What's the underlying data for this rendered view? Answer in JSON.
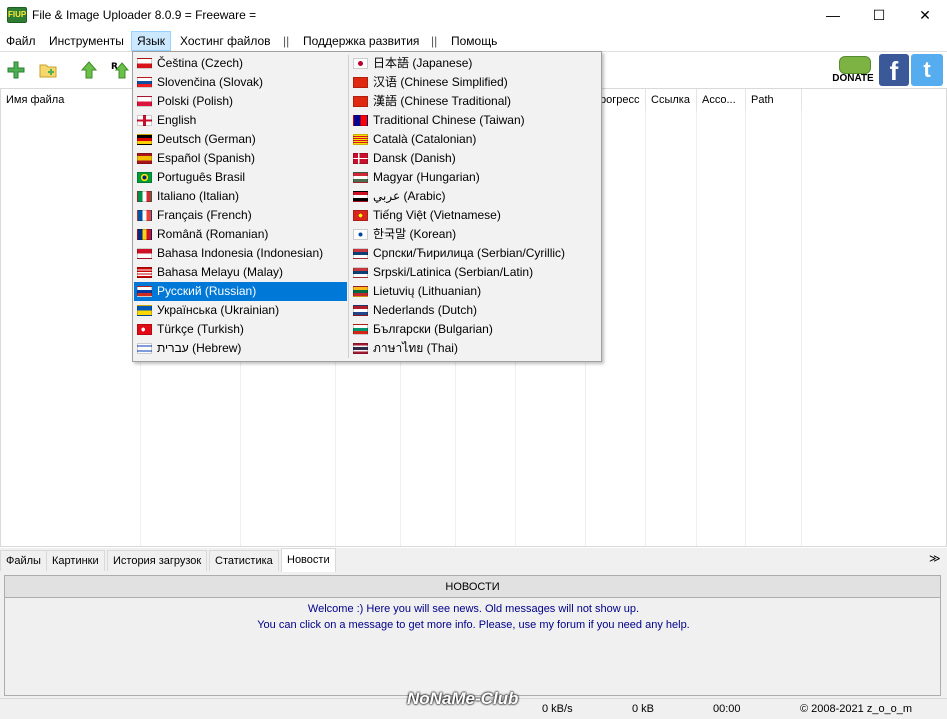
{
  "window": {
    "title": "File & Image Uploader 8.0.9  = Freeware =",
    "app_icon_text": "FIUP",
    "minimize_glyph": "—",
    "maximize_glyph": "☐",
    "close_glyph": "✕"
  },
  "menu": {
    "items": [
      "Файл",
      "Инструменты",
      "Язык",
      "Хостинг файлов",
      "||",
      "Поддержка развития",
      "||",
      "Помощь"
    ],
    "active": "Язык"
  },
  "toolbar": {
    "donate_label": "DONATE",
    "facebook_glyph": "f",
    "twitter_glyph": "t"
  },
  "grid": {
    "headers": [
      "Имя файла",
      "",
      "",
      "",
      "",
      "",
      "",
      "рогресс",
      "Ссылка",
      "Acco...",
      "Path"
    ]
  },
  "language_menu": {
    "left": [
      {
        "label": "Čeština (Czech)",
        "flag": "czech"
      },
      {
        "label": "Slovenčina (Slovak)",
        "flag": "slovak"
      },
      {
        "label": "Polski (Polish)",
        "flag": "polish"
      },
      {
        "label": "English",
        "flag": "english"
      },
      {
        "label": "Deutsch (German)",
        "flag": "german"
      },
      {
        "label": "Español (Spanish)",
        "flag": "spanish"
      },
      {
        "label": "Português Brasil",
        "flag": "brazil"
      },
      {
        "label": "Italiano (Italian)",
        "flag": "italian"
      },
      {
        "label": "Français (French)",
        "flag": "french"
      },
      {
        "label": "Română (Romanian)",
        "flag": "romanian"
      },
      {
        "label": "Bahasa Indonesia (Indonesian)",
        "flag": "indonesian"
      },
      {
        "label": "Bahasa Melayu (Malay)",
        "flag": "malay"
      },
      {
        "label": "Русский (Russian)",
        "flag": "russian"
      },
      {
        "label": "Українська (Ukrainian)",
        "flag": "ukrainian"
      },
      {
        "label": "Türkçe (Turkish)",
        "flag": "turkish"
      },
      {
        "label": "עברית (Hebrew)",
        "flag": "hebrew"
      }
    ],
    "right": [
      {
        "label": "日本語 (Japanese)",
        "flag": "japanese"
      },
      {
        "label": "汉语 (Chinese Simplified)",
        "flag": "chinese"
      },
      {
        "label": "漢語 (Chinese Traditional)",
        "flag": "chinese"
      },
      {
        "label": "Traditional Chinese (Taiwan)",
        "flag": "taiwan"
      },
      {
        "label": "Català (Catalonian)",
        "flag": "catalan"
      },
      {
        "label": "Dansk (Danish)",
        "flag": "danish"
      },
      {
        "label": "Magyar (Hungarian)",
        "flag": "hungarian"
      },
      {
        "label": "عربي (Arabic)",
        "flag": "arabic"
      },
      {
        "label": "Tiếng Việt (Vietnamese)",
        "flag": "vietnamese"
      },
      {
        "label": "한국말 (Korean)",
        "flag": "korean"
      },
      {
        "label": "Српски/Ћирилица (Serbian/Cyrillic)",
        "flag": "serbian"
      },
      {
        "label": "Srpski/Latinica (Serbian/Latin)",
        "flag": "serbian"
      },
      {
        "label": "Lietuvių (Lithuanian)",
        "flag": "lithuanian"
      },
      {
        "label": "Nederlands (Dutch)",
        "flag": "dutch"
      },
      {
        "label": "Български (Bulgarian)",
        "flag": "bulgarian"
      },
      {
        "label": "ภาษาไทย (Thai)",
        "flag": "thai"
      }
    ],
    "highlighted": "Русский (Russian)"
  },
  "tabs": {
    "items": [
      "Файлы",
      "Картинки",
      "История загрузок",
      "Статистика",
      "Новости"
    ],
    "active": "Новости",
    "collapse_glyph": "≫"
  },
  "news": {
    "button_label": "НОВОСТИ",
    "lines": [
      "Welcome :) Here you will see news. Old messages will not show up.",
      "You can click on a message to get more info. Please, use my forum if you need any help."
    ]
  },
  "status": {
    "speed": "0 kB/s",
    "size": "0 kB",
    "time": "00:00",
    "copyright": "© 2008-2021 z_o_o_m"
  },
  "watermark": "NoNaMe-Club",
  "colors": {
    "highlight": "#0078d7",
    "news_text": "#00008b",
    "menu_active": "#cce8ff"
  }
}
